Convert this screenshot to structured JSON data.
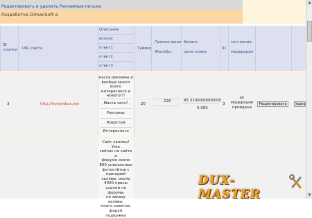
{
  "top": {
    "title": "Редактировать и удалить Рекламные письма"
  },
  "section": {
    "title": "Разработка DimanSoft-a"
  },
  "headers": {
    "id_ssylki": [
      "ID",
      "ссылки"
    ],
    "url": "URL сайта",
    "q": [
      "Описание",
      "вопрос",
      "ответ1",
      "ответ2",
      "ответ3"
    ],
    "timer": "Таймер",
    "viewed": [
      "Просмотрено",
      "Жалобы"
    ],
    "balance": [
      "баланс",
      "цена клика"
    ],
    "id": "ID",
    "state": [
      "состояние",
      "модерация"
    ]
  },
  "rows": [
    {
      "id_ssylki": "3",
      "url": "http://honestbus.net",
      "desc": [
        "масса рекламы и",
        "вообще много",
        "всего",
        "интересного и",
        "нового!!!"
      ],
      "q": "Масса чего?",
      "a1": "Рекламы",
      "a2": "Новостей",
      "a3": "Интересного",
      "timer": "20",
      "viewed": "226",
      "balance": "85.3100000000005",
      "price": "0.065",
      "id": "3",
      "state": [
        "on",
        "модерация",
        "пройдена"
      ],
      "edit": "Редактировать",
      "del": "Удалить"
    }
  ],
  "row2": {
    "desc": [
      "Сайт халявы! Уже",
      "сейчас на сайте и",
      "форуме около",
      "800 уникальных",
      "фотосчётов с",
      "принцией",
      "халявы, около",
      "4000 призы",
      "ссылки на форумы",
      "по заказу халявы,",
      "много советов,",
      "форум подержки"
    ]
  },
  "logo": {
    "text": "DUX-MASTER"
  }
}
